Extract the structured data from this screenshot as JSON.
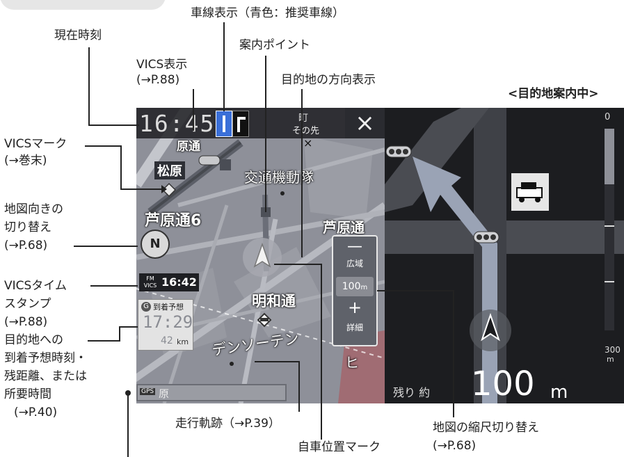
{
  "callouts": {
    "lane_display": "車線表示（青色：推奨車線）",
    "current_time": "現在時刻",
    "guide_point": "案内ポイント",
    "vics_display": "VICS表示",
    "vics_display_ref": "(→P.88)",
    "dest_direction": "目的地の方向表示",
    "mode": "<目的地案内中>",
    "vics_mark": "VICSマーク",
    "vics_mark_ref": "(→巻末)",
    "map_orient_1": "地図向きの",
    "map_orient_2": "切り替え",
    "map_orient_ref": "(→P.68)",
    "vics_time_1": "VICSタイム",
    "vics_time_2": "スタンプ",
    "vics_time_ref": "(→P.88)",
    "arrival_1": "目的地への",
    "arrival_2": "到着予想時刻・",
    "arrival_3": "残距離、または",
    "arrival_4": "所要時間",
    "arrival_ref": "(→P.40)",
    "track": "走行軌跡（→P.39）",
    "own_car": "自車位置マーク",
    "scale_switch": "地図の縮尺切り替え",
    "scale_switch_ref": "(→P.68)"
  },
  "screen": {
    "clock": "16:45",
    "next_label": "その先",
    "vics_time_badge": "VICS",
    "vics_time_fm": "FM",
    "vics_time": "16:42",
    "arrival_label": "到着予想",
    "arrival_icon": "G",
    "arrival_time": "17:29",
    "remaining_dist": "42",
    "remaining_unit": "km",
    "gps_label": "GPS",
    "scale": {
      "minus": "—",
      "wide": "広域",
      "value": "100",
      "unit": "m",
      "plus": "+",
      "detail": "詳細"
    },
    "guide": {
      "remaining_label": "残り 約",
      "distance": "100",
      "distance_unit": "m",
      "bar_top": "0",
      "bar_bottom": "300",
      "bar_bottom_unit": "m"
    },
    "place_names": {
      "matsubara": "松原",
      "koutsu": "交通機動隊",
      "ashihara6": "芦原通6",
      "ashihara": "芦原通",
      "meiwa": "明和通",
      "denso": "デンソーテン",
      "hi": "ヒ",
      "top_road": "原通",
      "top_right": "町",
      "map_bottom": "原"
    },
    "compass": "N"
  },
  "colors": {
    "lane_recommended": "#3a6fd8",
    "route_arrow": "#9aa3b5",
    "map_bg": "#8d8f98",
    "guide_bg": "#1c1d20"
  }
}
